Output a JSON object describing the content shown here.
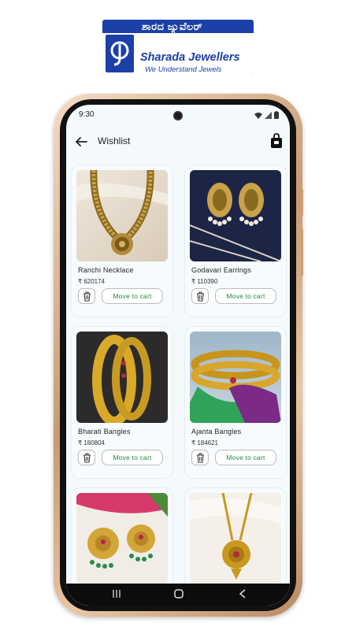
{
  "brand": {
    "kannada_name": "ಶಾರದ ಜ್ಯುವೆಲರ್",
    "english_name": "Sharada Jewellers",
    "tagline": "We Understand Jewels"
  },
  "status_bar": {
    "time": "9:30"
  },
  "appbar": {
    "title": "Wishlist"
  },
  "colors": {
    "brand_blue": "#1c3fa8",
    "cart_text": "#1f8a3c",
    "screen_bg": "#f4f9fb"
  },
  "products": [
    {
      "name": "Ranchi Necklace",
      "price": "₹ 620174",
      "cart_label": "Move to cart"
    },
    {
      "name": "Godavari Earrings",
      "price": "₹ 110390",
      "cart_label": "Move to cart"
    },
    {
      "name": "Bharati Bangles",
      "price": "₹ 180804",
      "cart_label": "Move to cart"
    },
    {
      "name": "Ajanta Bangles",
      "price": "₹ 184621",
      "cart_label": "Move to cart"
    },
    {
      "name": "",
      "price": "",
      "cart_label": ""
    },
    {
      "name": "",
      "price": "",
      "cart_label": ""
    }
  ]
}
